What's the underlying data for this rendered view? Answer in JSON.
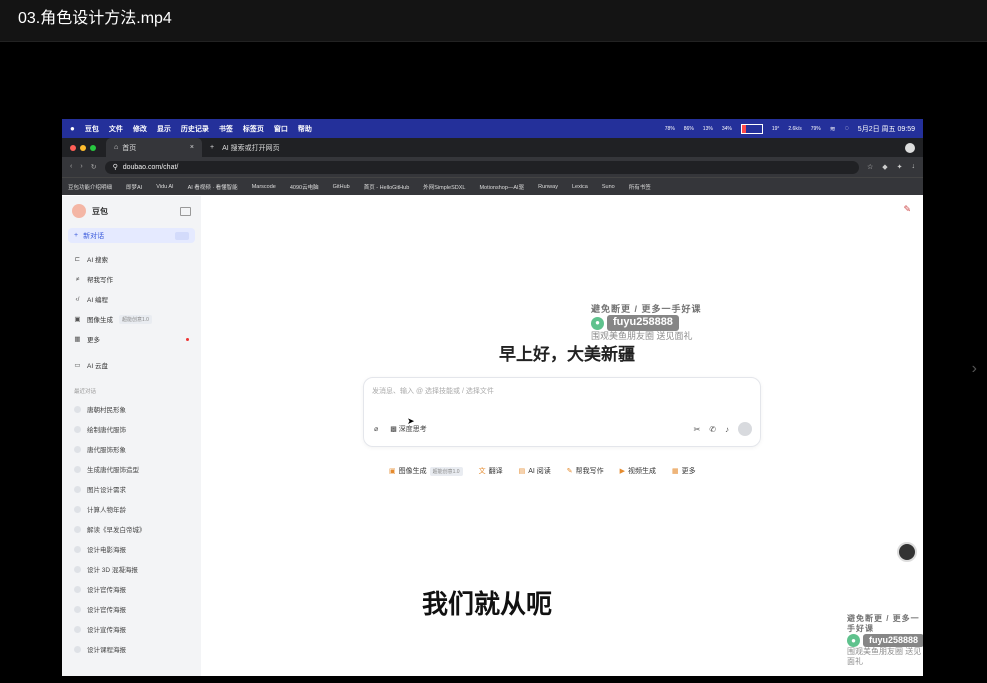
{
  "player": {
    "title": "03.角色设计方法.mp4",
    "next_icon": "chevron-right-icon"
  },
  "menubar": {
    "apple": "",
    "items": [
      "豆包",
      "文件",
      "修改",
      "显示",
      "历史记录",
      "书签",
      "标签页",
      "窗口",
      "帮助"
    ],
    "stats": [
      "78%",
      "86%",
      "13%",
      "34%",
      "19°",
      "2.6k/s",
      "79%"
    ],
    "datetime": "5月2日 周五 09:59"
  },
  "tabs": {
    "active": "首页",
    "new_tab": "AI 搜索或打开网页"
  },
  "address": {
    "url": "doubao.com/chat/"
  },
  "bookmarks": [
    "豆包功能介绍明细",
    "即梦AI",
    "Vidu AI",
    "AI 看视频 · 看懂智能",
    "Marscode",
    "4090云电脑",
    "GitHub",
    "首页 - HelloGitHub",
    "外网SimpleSDXL",
    "Motionshop—AI驱",
    "Runway",
    "Lexica",
    "Suno",
    "所有书签"
  ],
  "sidebar": {
    "brand": "豆包",
    "new_chat": "新对话",
    "items": [
      {
        "icon": "ai-search-icon",
        "label": "AI 搜索"
      },
      {
        "icon": "write-icon",
        "label": "帮我写作"
      },
      {
        "icon": "code-icon",
        "label": "AI 编程"
      },
      {
        "icon": "image-icon",
        "label": "图像生成",
        "badge": "超能创意1.0"
      },
      {
        "icon": "more-icon",
        "label": "更多"
      }
    ],
    "cloud": "AI 云盘",
    "section": "最近对话",
    "history": [
      "唐朝村民形象",
      "绘制唐代服饰",
      "唐代服饰形象",
      "生成唐代服饰造型",
      "图片设计需求",
      "计算人物年龄",
      "解读《早发白帝城》",
      "设计电影海报",
      "设计 3D 混凝海报",
      "设计官传海报",
      "设计官传海报",
      "设计宣传海报",
      "设计课程海报"
    ]
  },
  "main": {
    "greeting": "早上好，大美新疆",
    "input_placeholder": "发消息、输入 @ 选择技能或 / 选择文件",
    "attach_icon": "paperclip-icon",
    "deep_think": "深度思考",
    "quick_actions": [
      "图像生成",
      "超能创意1.0",
      "翻译",
      "AI 阅读",
      "帮我写作",
      "视频生成",
      "更多"
    ],
    "subtitle": "我们就从呃"
  },
  "watermark": {
    "line1": "避免断更 / 更多一手好课",
    "wechat_id": "fuyu258888",
    "line3": "围观美鱼朋友圈 送见面礼"
  }
}
